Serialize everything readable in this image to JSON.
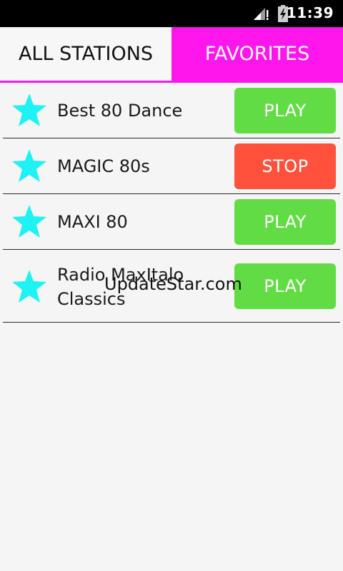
{
  "status_bar": {
    "time": "11:39",
    "icons": [
      "signal-icon",
      "battery-charging-icon"
    ]
  },
  "tabs": [
    {
      "label": "ALL STATIONS",
      "active": false
    },
    {
      "label": "FAVORITES",
      "active": true
    }
  ],
  "stations": [
    {
      "name": "Best 80 Dance",
      "button": "PLAY",
      "state": "stopped"
    },
    {
      "name": "MAGIC 80s",
      "button": "STOP",
      "state": "playing"
    },
    {
      "name": "MAXI 80",
      "button": "PLAY",
      "state": "stopped"
    },
    {
      "name": "Radio MaxItalo Classics",
      "name_line1": "Radio MaxItalo",
      "name_line2": "Classics",
      "button": "PLAY",
      "state": "stopped"
    }
  ],
  "watermark": "UpdateStar.com",
  "colors": {
    "accent": "#ff16ec",
    "star": "#1ef2f4",
    "play": "#62dc44",
    "stop": "#ff513b",
    "status_bar": "#000000"
  }
}
